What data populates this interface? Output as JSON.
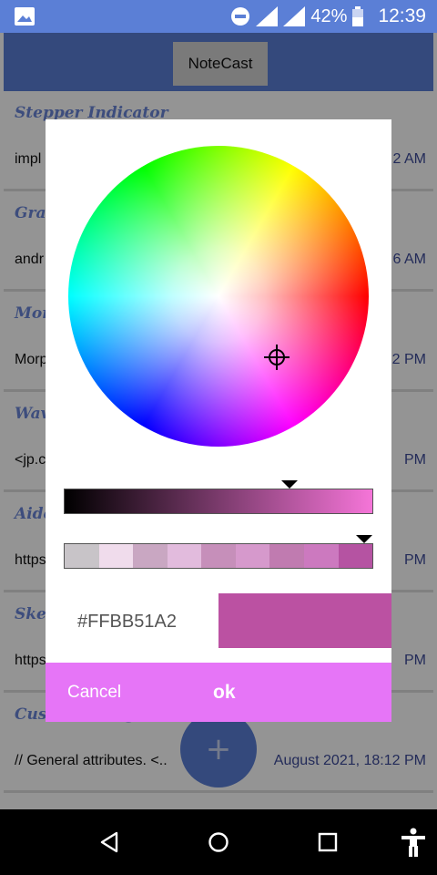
{
  "status_bar": {
    "battery": "42%",
    "time": "12:39",
    "icons": [
      "image-icon",
      "do-not-disturb-icon",
      "signal-icon",
      "signal-icon",
      "battery-icon"
    ]
  },
  "app": {
    "title": "NoteCast"
  },
  "notes": [
    {
      "title": "Stepper Indicator",
      "desc": "impl",
      "time": "2 AM"
    },
    {
      "title": "Grac",
      "desc": "andr",
      "time": "6 AM"
    },
    {
      "title": "Mor",
      "desc": "Morp",
      "time": "2 PM"
    },
    {
      "title": "Wav",
      "desc": "<jp.c",
      "time": "PM"
    },
    {
      "title": "Aide",
      "desc": "https",
      "time": "PM"
    },
    {
      "title": "Sket",
      "desc": "https",
      "time": "PM"
    },
    {
      "title": "Custom Navigation",
      "desc": "// General  attributes. <..",
      "time": "August 2021, 18:12 PM"
    }
  ],
  "fab": {
    "icon": "plus-icon",
    "label": "+"
  },
  "color_picker": {
    "hex_value": "#FFBB51A2",
    "selected_color": "#bb51a2",
    "lightness": 0.73,
    "alpha": 1.0,
    "alpha_swatches": [
      "#c8c4c8",
      "#f0dcec",
      "#c9a7c2",
      "#e2bbdd",
      "#c68fba",
      "#d699cc",
      "#c07bb0",
      "#cc79bf",
      "#b553a2"
    ],
    "cancel_label": "Cancel",
    "ok_label": "ok"
  },
  "colors": {
    "primary": "#5b7fd6",
    "accent": "#e675f7"
  }
}
